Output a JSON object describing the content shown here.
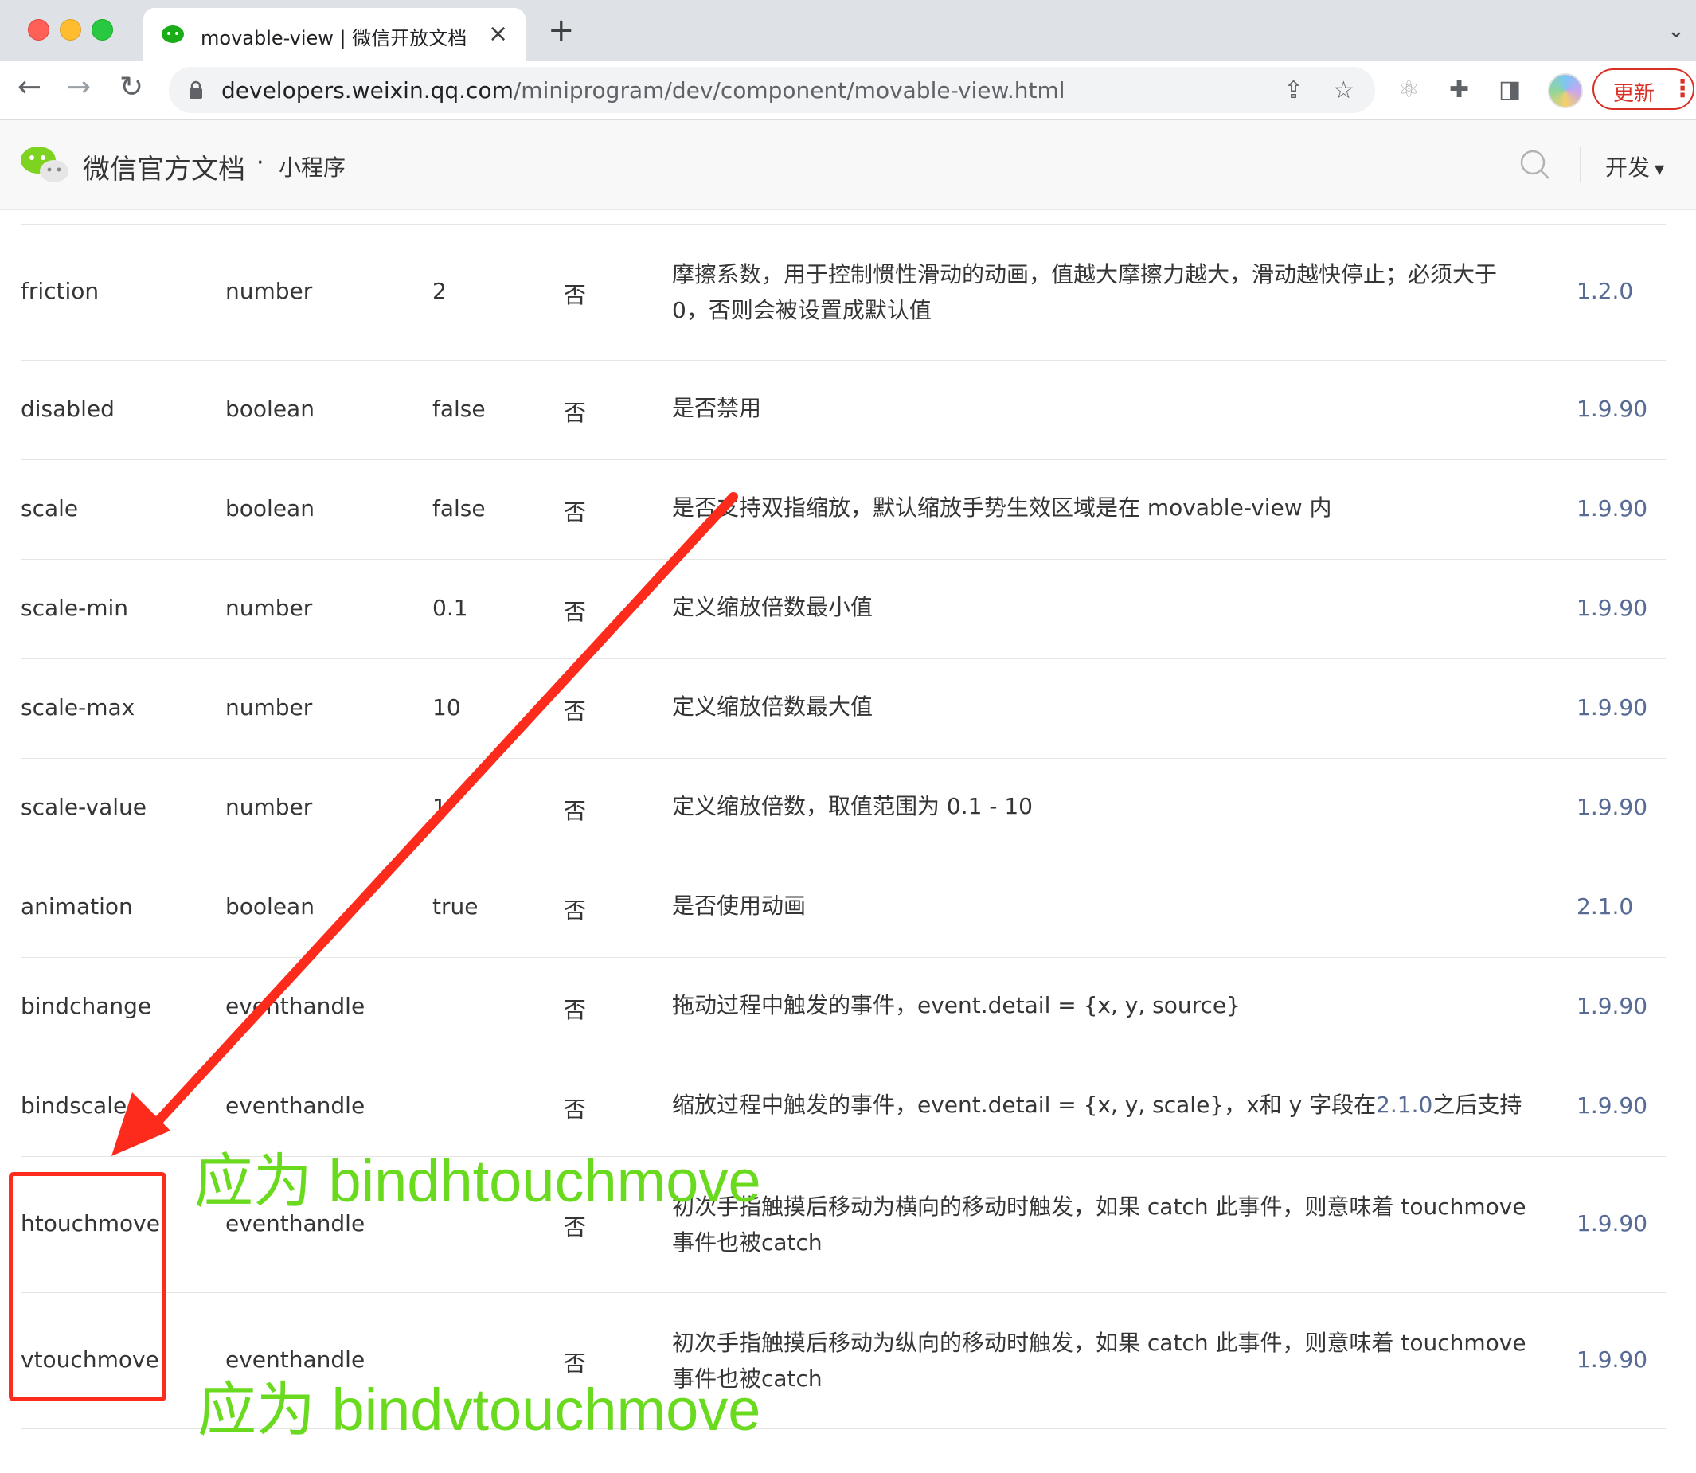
{
  "browser": {
    "tab_title": "movable-view | 微信开放文档",
    "url_host": "developers.weixin.qq.com",
    "url_path": "/miniprogram/dev/component/movable-view.html",
    "update_label": "更新"
  },
  "site_header": {
    "title": "微信官方文档",
    "dot": "·",
    "section": "小程序",
    "dev_menu": "开发"
  },
  "table": {
    "rows": [
      {
        "name": "friction",
        "type": "number",
        "default": "2",
        "required": "否",
        "desc": "摩擦系数，用于控制惯性滑动的动画，值越大摩擦力越大，滑动越快停止；必须大于0，否则会被设置成默认值",
        "version": "1.2.0"
      },
      {
        "name": "disabled",
        "type": "boolean",
        "default": "false",
        "required": "否",
        "desc": "是否禁用",
        "version": "1.9.90"
      },
      {
        "name": "scale",
        "type": "boolean",
        "default": "false",
        "required": "否",
        "desc": "是否支持双指缩放，默认缩放手势生效区域是在 movable-view 内",
        "version": "1.9.90"
      },
      {
        "name": "scale-min",
        "type": "number",
        "default": "0.1",
        "required": "否",
        "desc": "定义缩放倍数最小值",
        "version": "1.9.90"
      },
      {
        "name": "scale-max",
        "type": "number",
        "default": "10",
        "required": "否",
        "desc": "定义缩放倍数最大值",
        "version": "1.9.90"
      },
      {
        "name": "scale-value",
        "type": "number",
        "default": "1",
        "required": "否",
        "desc": "定义缩放倍数，取值范围为 0.1 - 10",
        "version": "1.9.90"
      },
      {
        "name": "animation",
        "type": "boolean",
        "default": "true",
        "required": "否",
        "desc": "是否使用动画",
        "version": "2.1.0"
      },
      {
        "name": "bindchange",
        "type": "eventhandle",
        "default": "",
        "required": "否",
        "desc": "拖动过程中触发的事件，event.detail = {x, y, source}",
        "version": "1.9.90"
      },
      {
        "name": "bindscale",
        "type": "eventhandle",
        "default": "",
        "required": "否",
        "desc_before": "缩放过程中触发的事件，event.detail = {x, y, scale}，x和 y 字段在",
        "desc_link": "2.1.0",
        "desc_after": "之后支持",
        "version": "1.9.90"
      },
      {
        "name": "htouchmove",
        "type": "eventhandle",
        "default": "",
        "required": "否",
        "desc": "初次手指触摸后移动为横向的移动时触发，如果 catch 此事件，则意味着 touchmove 事件也被catch",
        "version": "1.9.90"
      },
      {
        "name": "vtouchmove",
        "type": "eventhandle",
        "default": "",
        "required": "否",
        "desc": "初次手指触摸后移动为纵向的移动时触发，如果 catch 此事件，则意味着 touchmove 事件也被catch",
        "version": "1.9.90"
      }
    ]
  },
  "annotations": {
    "h_note": "应为 bindhtouchmove",
    "v_note": "应为 bindvtouchmove"
  },
  "colors": {
    "link": "#576b95",
    "annotation_red": "#fc2b1c",
    "annotation_green": "#6ada1f",
    "update_red": "#d93025"
  }
}
